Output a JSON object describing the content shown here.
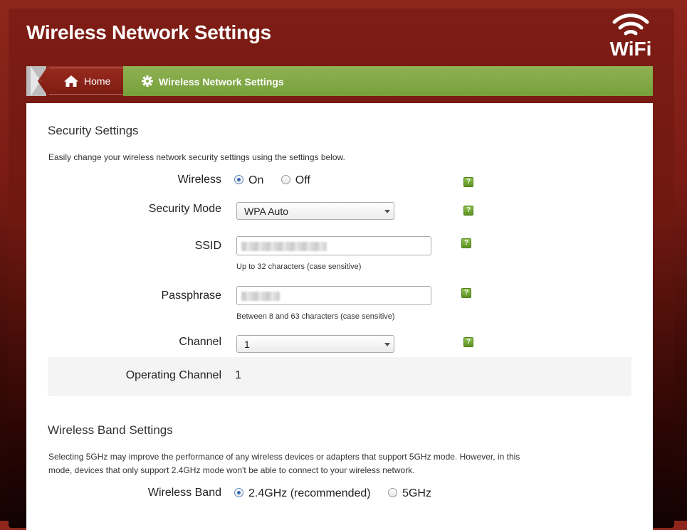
{
  "header": {
    "title": "Wireless Network Settings",
    "logo_text": "WiFi"
  },
  "breadcrumb": {
    "home_label": "Home",
    "current_label": "Wireless Network Settings"
  },
  "security": {
    "title": "Security Settings",
    "description": "Easily change your wireless network security settings using the settings below.",
    "wireless": {
      "label": "Wireless",
      "options": [
        "On",
        "Off"
      ],
      "selected": "On"
    },
    "security_mode": {
      "label": "Security Mode",
      "value": "WPA Auto"
    },
    "ssid": {
      "label": "SSID",
      "hint": "Up to 32 characters (case sensitive)"
    },
    "passphrase": {
      "label": "Passphrase",
      "hint": "Between 8 and 63 characters (case sensitive)"
    },
    "channel": {
      "label": "Channel",
      "value": "1"
    },
    "operating_channel": {
      "label": "Operating Channel",
      "value": "1"
    },
    "help_symbol": "?"
  },
  "band": {
    "title": "Wireless Band Settings",
    "description": "Selecting 5GHz may improve the performance of any wireless devices or adapters that support 5GHz mode. However, in this mode, devices that only support 2.4GHz mode won't be able to connect to your wireless network.",
    "wireless_band": {
      "label": "Wireless Band",
      "options": [
        "2.4GHz (recommended)",
        "5GHz"
      ],
      "selected": "2.4GHz (recommended)"
    }
  },
  "colors": {
    "header_red": "#7e1d15",
    "breadcrumb_green": "#83a948",
    "help_green": "#6ea133"
  }
}
